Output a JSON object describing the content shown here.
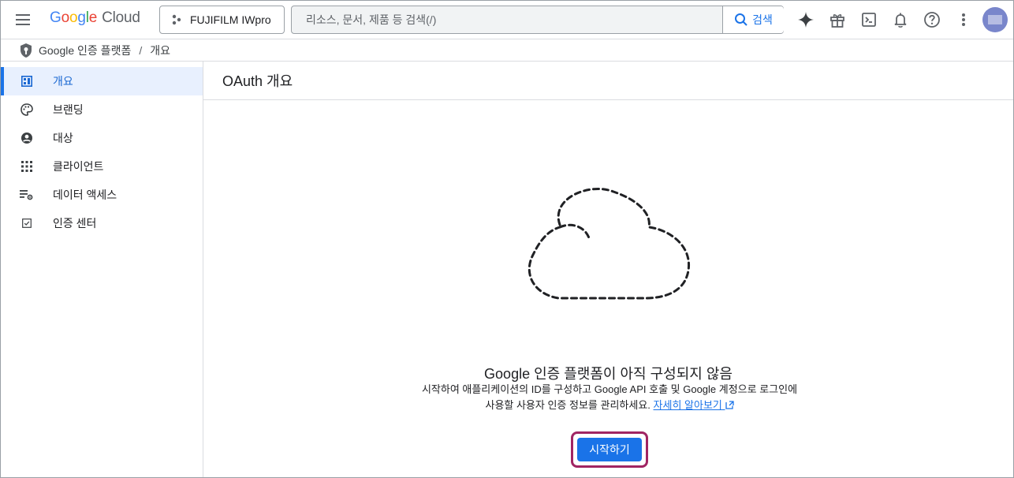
{
  "header": {
    "logo_letters": [
      "G",
      "o",
      "o",
      "g",
      "l",
      "e"
    ],
    "logo_suffix": "Cloud",
    "project_name": "FUJIFILM IWpro",
    "search_placeholder": "리소스, 문서, 제품 등 검색(/)",
    "search_button_label": "검색",
    "icons": [
      "menu-icon",
      "gemini-sparkle-icon",
      "gift-icon",
      "cloud-shell-icon",
      "bell-icon",
      "help-icon",
      "more-vert-icon"
    ]
  },
  "breadcrumb": {
    "items": [
      "Google 인증 플랫폼",
      "개요"
    ],
    "separator": "/"
  },
  "sidebar": {
    "items": [
      {
        "label": "개요",
        "icon": "dashboard-icon",
        "active": true
      },
      {
        "label": "브랜딩",
        "icon": "palette-icon",
        "active": false
      },
      {
        "label": "대상",
        "icon": "account-circle-icon",
        "active": false
      },
      {
        "label": "클라이언트",
        "icon": "apps-grid-icon",
        "active": false
      },
      {
        "label": "데이터 액세스",
        "icon": "data-settings-icon",
        "active": false
      },
      {
        "label": "인증 센터",
        "icon": "checkbox-icon",
        "active": false
      }
    ]
  },
  "main": {
    "title": "OAuth 개요",
    "empty_state": {
      "title": "Google 인증 플랫폼이 아직 구성되지 않음",
      "description": "시작하여 애플리케이션의 ID를 구성하고 Google API 호출 및 Google 계정으로 로그인에 사용할 사용자 인증 정보를 관리하세요.",
      "learn_more_label": "자세히 알아보기",
      "start_button_label": "시작하기"
    }
  },
  "colors": {
    "accent": "#1a73e8",
    "active_bg": "#e8f0fe",
    "highlight_border": "#a02563"
  }
}
